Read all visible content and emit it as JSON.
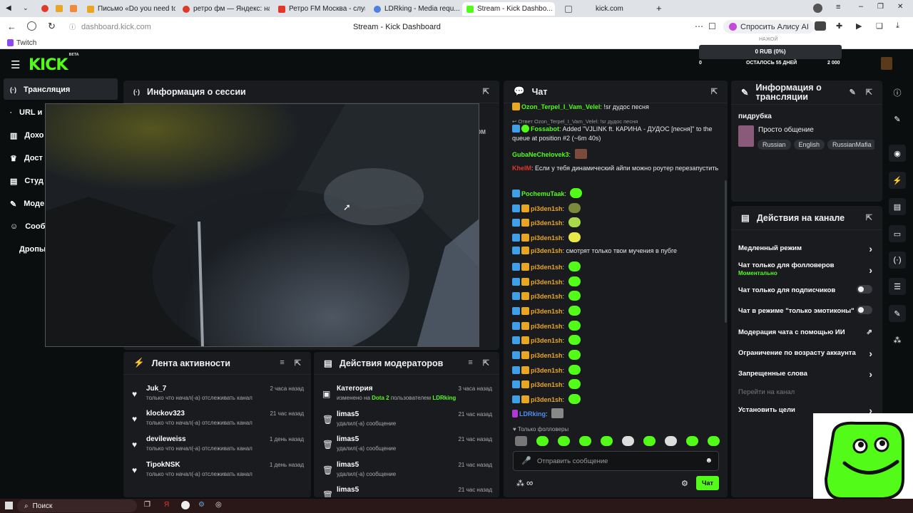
{
  "browser": {
    "tabs": [
      {
        "label": "Письмо «Do you need to ...",
        "color": "#e8a623"
      },
      {
        "label": "ретро фм — Яндекс: наш...",
        "color": "#e0382b"
      },
      {
        "label": "Ретро FM Москва - слуш...",
        "color": "#e0382b"
      },
      {
        "label": "LDRking - Media requ...",
        "color": "#4f7fe0"
      },
      {
        "label": "Stream - Kick Dashbo...",
        "color": "#53fc18"
      },
      {
        "label": "kick.com",
        "color": "#888888"
      }
    ],
    "url": "dashboard.kick.com",
    "page_title": "Stream - Kick Dashboard",
    "alice_label": "Спросить Алису AI",
    "bookmark": "Twitch"
  },
  "kick": {
    "logo": "KICK",
    "logo_beta": "BETA",
    "goal": {
      "tooltip": "НАЖОЙ",
      "amount": "0 RUB (0%)",
      "start": "0",
      "days_left": "ОСТАЛОСЬ 55 ДНЕЙ",
      "target": "2 000"
    }
  },
  "sidebar": {
    "items": [
      {
        "label": "Трансляция",
        "icon": "broadcast-icon"
      },
      {
        "label": "URL и к",
        "icon": "dot-icon"
      },
      {
        "label": "Дохо",
        "icon": "chart-icon"
      },
      {
        "label": "Дост",
        "icon": "trophy-icon"
      },
      {
        "label": "Студ",
        "icon": "studio-icon"
      },
      {
        "label": "Моде",
        "icon": "wrench-icon"
      },
      {
        "label": "Сооб",
        "icon": "community-icon"
      },
      {
        "label": "Дропы",
        "icon": ""
      }
    ]
  },
  "session": {
    "title": "Информация о сессии",
    "partial_label": "ОМ"
  },
  "activity": {
    "title": "Лента активности",
    "items": [
      {
        "name": "Juk_7",
        "time": "2 часа назад",
        "sub": "только что начал(-а) отслеживать канал"
      },
      {
        "name": "klockov323",
        "time": "21 час назад",
        "sub": "только что начал(-а) отслеживать канал"
      },
      {
        "name": "devileweiss",
        "time": "1 день назад",
        "sub": "только что начал(-а) отслеживать канал"
      },
      {
        "name": "TipokNSK",
        "time": "1 день назад",
        "sub": "только что начал(-а) отслеживать канал"
      }
    ]
  },
  "modactions": {
    "title": "Действия модераторов",
    "category": {
      "name": "Категория",
      "time": "3 часа назад",
      "pre": "изменено на ",
      "game": "Dota 2",
      "mid": " пользователем ",
      "user": "LDRking"
    },
    "items": [
      {
        "name": "limas5",
        "time": "21 час назад",
        "sub": "удалил(-а) сообщение"
      },
      {
        "name": "limas5",
        "time": "21 час назад",
        "sub": "удалил(-а) сообщение"
      },
      {
        "name": "limas5",
        "time": "21 час назад",
        "sub": "удалил(-а) сообщение"
      },
      {
        "name": "limas5",
        "time": "21 час назад",
        "sub": ""
      }
    ]
  },
  "chat": {
    "title": "Чат",
    "top_line": {
      "user": "Ozon_Terpel_I_Vam_Velel",
      "text": "!sr дудос песня"
    },
    "reply_line": "Ответ Ozon_Terpel_I_Vam_Velel: !sr дудос песня",
    "bot_line": {
      "user": "Fossabot",
      "text": "Added \"VJLINK ft. КАРИНА - ДУДОС [песня]\" to the queue at position #2 (~6m 40s)"
    },
    "guba": {
      "user": "GubaNeChelovek3"
    },
    "khel": {
      "user": "KhelM",
      "text": "Если у тебя динамический айпи можно роутер перезапустить"
    },
    "pochemu": {
      "user": "PochemuTaak"
    },
    "spam_user": "pi3den1sh",
    "spam_text": "смотрят только твои мучения в пубге",
    "owner": "LDRking",
    "followers_only": "Только фолловеры",
    "input_placeholder": "Отправить сообщение",
    "send_label": "Чат"
  },
  "stream_info": {
    "title": "Информация о трансляции",
    "stream_title": "пидрубка",
    "category": "Просто общение",
    "tags": [
      "Russian",
      "English",
      "RussianMafia"
    ]
  },
  "channel_actions": {
    "title": "Действия на канале",
    "rows": [
      {
        "label": "Медленный режим",
        "control": "chevron"
      },
      {
        "label": "Чат только для фолловеров",
        "sub": "Моментально",
        "control": "chevron"
      },
      {
        "label": "Чат только для подписчиков",
        "control": "toggle"
      },
      {
        "label": "Чат в режиме \"только эмотиконы\"",
        "control": "toggle"
      },
      {
        "label": "Модерация чата с помощью ИИ",
        "control": "external"
      },
      {
        "label": "Ограничение по возрасту аккаунта",
        "control": "chevron"
      },
      {
        "label": "Запрещенные слова",
        "control": "chevron"
      },
      {
        "label": "Перейти на канал",
        "control": "none"
      },
      {
        "label": "Установить цели",
        "control": "chevron"
      }
    ]
  },
  "taskbar": {
    "search": "Поиск"
  }
}
